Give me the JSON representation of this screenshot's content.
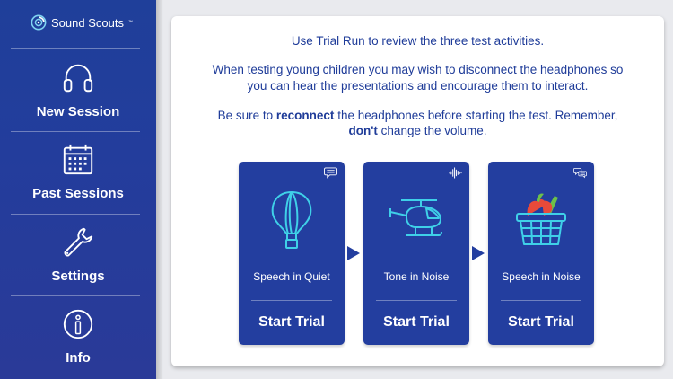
{
  "brand": {
    "name": "Sound Scouts",
    "trademark": "™",
    "icon": "swirl-logo-icon"
  },
  "sidebar": {
    "items": [
      {
        "label": "New Session",
        "icon": "headphones-icon"
      },
      {
        "label": "Past Sessions",
        "icon": "calendar-icon"
      },
      {
        "label": "Settings",
        "icon": "wrench-icon"
      },
      {
        "label": "Info",
        "icon": "info-icon"
      }
    ]
  },
  "intro": {
    "line1": "Use Trial Run to review the three test activities.",
    "line2a": "When testing young children you may wish to disconnect the headphones so",
    "line2b": "you can hear the presentations and encourage them to interact.",
    "line3_pre": "Be sure to ",
    "line3_bold": "reconnect",
    "line3_post": " the headphones before starting the test. Remember,",
    "line4_bold": "don't",
    "line4_post": " change the volume."
  },
  "cards": [
    {
      "name": "Speech in Quiet",
      "action": "Start Trial",
      "art": "hot-air-balloon-icon",
      "corner": "speech-bubble-icon"
    },
    {
      "name": "Tone in Noise",
      "action": "Start Trial",
      "art": "helicopter-icon",
      "corner": "sound-wave-icon"
    },
    {
      "name": "Speech in Noise",
      "action": "Start Trial",
      "art": "picnic-basket-icon",
      "corner": "speech-bubbles-icon"
    }
  ],
  "colors": {
    "sidebar": "#233d9c",
    "accent": "#233e9f",
    "text": "#1f3c99",
    "background": "#e9eaee"
  }
}
